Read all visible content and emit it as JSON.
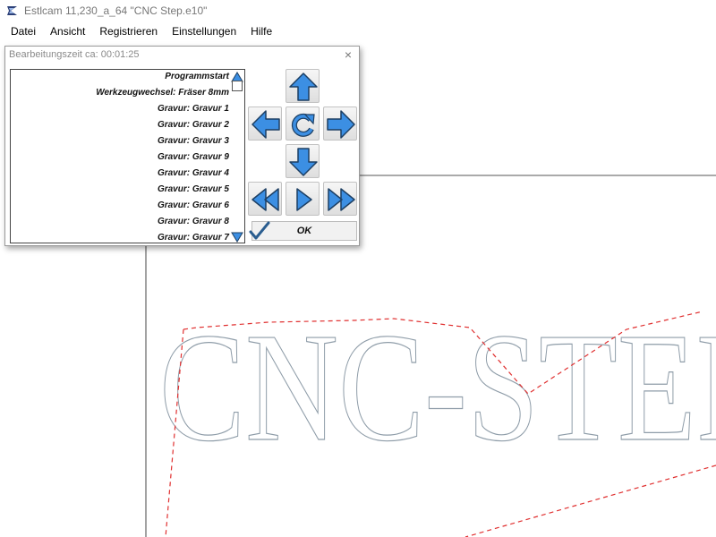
{
  "window": {
    "title": "Estlcam 11,230_a_64 \"CNC Step.e10\"",
    "icon": "estlcam-logo-icon"
  },
  "menu": {
    "items": [
      "Datei",
      "Ansicht",
      "Registrieren",
      "Einstellungen",
      "Hilfe"
    ]
  },
  "dialog": {
    "title": "Bearbeitungszeit ca: 00:01:25",
    "close_label": "×",
    "operations": [
      "Programmstart",
      "Werkzeugwechsel: Fräser 8mm",
      "Gravur: Gravur 1",
      "Gravur: Gravur 2",
      "Gravur: Gravur 3",
      "Gravur: Gravur 9",
      "Gravur: Gravur 4",
      "Gravur: Gravur 5",
      "Gravur: Gravur 6",
      "Gravur: Gravur 8",
      "Gravur: Gravur 7"
    ],
    "nav_buttons": [
      "arrow-up-icon",
      "arrow-left-icon",
      "rotate-icon",
      "arrow-right-icon",
      "arrow-down-icon",
      "rewind-icon",
      "play-icon",
      "fast-forward-icon"
    ],
    "ok_label": "OK",
    "colors": {
      "button_blue": "#3c8fe3",
      "button_outline": "#1d3f63",
      "checkmark": "#2a5d8f"
    }
  },
  "canvas": {
    "engraving_text": "CNC-STEP",
    "colors": {
      "outline": "#8e9ca8",
      "toolpath": "#e03030",
      "axis": "#444444"
    }
  }
}
